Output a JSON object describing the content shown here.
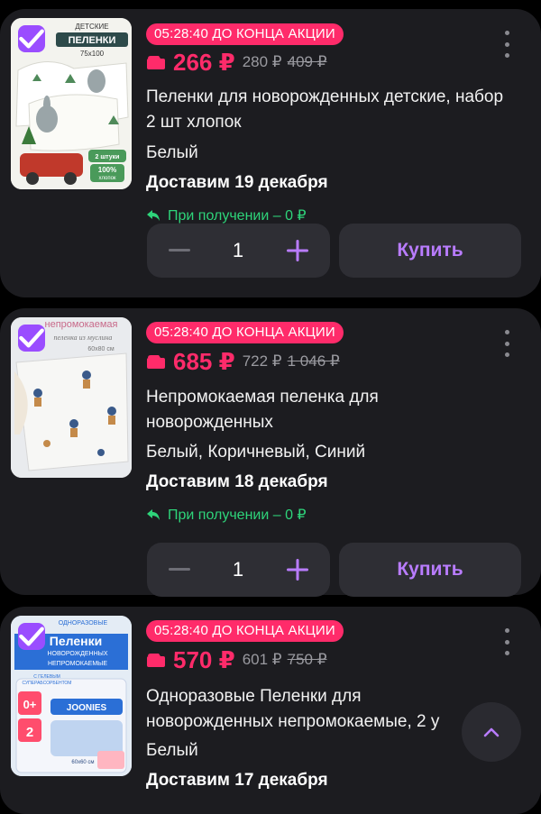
{
  "products": [
    {
      "timer": "05:28:40 ДО КОНЦА АКЦИИ",
      "price": "266 ₽",
      "price_old": "280 ₽",
      "price_crossed": "409 ₽",
      "title": "Пеленки для новорожденных детские, набор 2 шт хлопок",
      "color": "Белый",
      "delivery": "Доставим 19 декабря",
      "pickup": "При получении – 0 ₽",
      "quantity": "1",
      "buy_label": "Купить",
      "image_text": {
        "line1": "ДЕТСКИЕ",
        "line2": "ПЕЛЕНКИ",
        "line3": "75х100",
        "badge1": "2 штуки",
        "badge2": "100%",
        "badge3": "хлопок"
      }
    },
    {
      "timer": "05:28:40 ДО КОНЦА АКЦИИ",
      "price": "685 ₽",
      "price_old": "722 ₽",
      "price_crossed": "1 046 ₽",
      "title": "Непромокаемая пеленка для новорожденных",
      "color": "Белый, Коричневый, Синий",
      "delivery": "Доставим 18 декабря",
      "pickup": "При получении – 0 ₽",
      "quantity": "1",
      "buy_label": "Купить",
      "image_text": {
        "line1": "непромокаемая",
        "line2": "пеленка из муслина",
        "line3": "60х80 см"
      }
    },
    {
      "timer": "05:28:40 ДО КОНЦА АКЦИИ",
      "price": "570 ₽",
      "price_old": "601 ₽",
      "price_crossed": "750 ₽",
      "title": "Одноразовые Пеленки для новорожденных непромокаемые, 2 у",
      "color": "Белый",
      "delivery": "Доставим 17 декабря",
      "image_text": {
        "line1": "ОДНОРАЗОВЫЕ",
        "line2": "Пеленки",
        "line3": "НОВОРОЖДЕННЫХ",
        "line4": "НЕПРОМОКАЕМЫЕ",
        "badge1": "С ГЕЛЕВЫМ",
        "badge2": "СУПЕРАБСОРБЕНТОМ",
        "age": "0+",
        "count": "2",
        "brand": "JOONIES",
        "size": "60х60 см"
      }
    }
  ],
  "colors": {
    "accent_pink": "#ff2b6a",
    "accent_purple": "#9a4dff",
    "buy_text": "#b97cff",
    "pickup_green": "#2ed47a"
  }
}
